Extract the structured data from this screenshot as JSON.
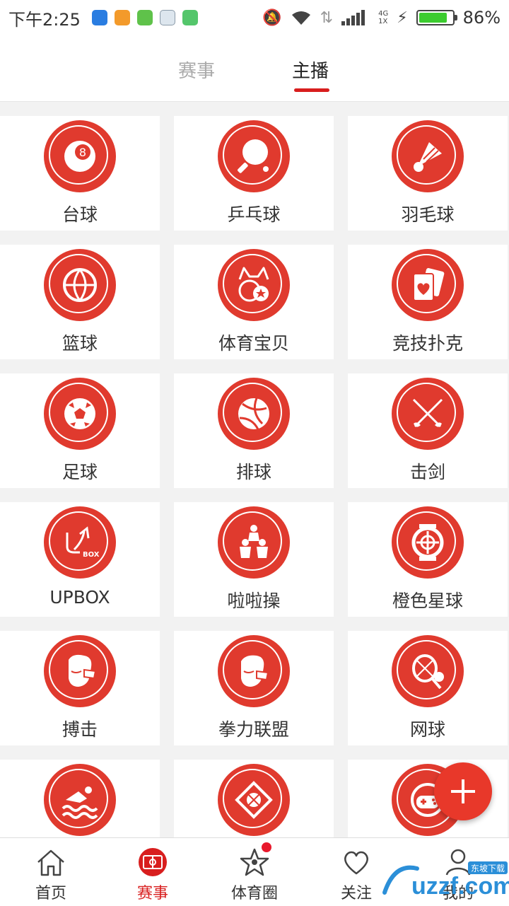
{
  "status_bar": {
    "time": "下午2:25",
    "network": "4G",
    "sim": "1X",
    "battery_percent": "86%",
    "battery_level": 0.86
  },
  "tabs": [
    {
      "label": "赛事",
      "active": false
    },
    {
      "label": "主播",
      "active": true
    }
  ],
  "categories": [
    {
      "label": "台球",
      "icon": "billiard-ball-icon"
    },
    {
      "label": "乒乓球",
      "icon": "ping-pong-icon"
    },
    {
      "label": "羽毛球",
      "icon": "shuttlecock-icon"
    },
    {
      "label": "篮球",
      "icon": "basketball-icon"
    },
    {
      "label": "体育宝贝",
      "icon": "cat-girl-icon"
    },
    {
      "label": "竞技扑克",
      "icon": "playing-cards-icon"
    },
    {
      "label": "足球",
      "icon": "soccer-ball-icon"
    },
    {
      "label": "排球",
      "icon": "volleyball-icon"
    },
    {
      "label": "击剑",
      "icon": "crossed-swords-icon"
    },
    {
      "label": "UPBOX",
      "icon": "upbox-logo-icon"
    },
    {
      "label": "啦啦操",
      "icon": "cheerleading-icon"
    },
    {
      "label": "橙色星球",
      "icon": "orange-planet-icon"
    },
    {
      "label": "搏击",
      "icon": "boxing-glove-icon"
    },
    {
      "label": "拳力联盟",
      "icon": "fist-league-icon"
    },
    {
      "label": "网球",
      "icon": "tennis-icon"
    },
    {
      "label": "",
      "icon": "swimming-icon"
    },
    {
      "label": "",
      "icon": "sport-x-icon"
    },
    {
      "label": "",
      "icon": "gamepad-icon"
    }
  ],
  "fab": {
    "icon": "plus-icon"
  },
  "bottom_nav": [
    {
      "label": "首页",
      "icon": "home-icon",
      "active": false
    },
    {
      "label": "赛事",
      "icon": "stadium-icon",
      "active": true
    },
    {
      "label": "体育圈",
      "icon": "star-pinwheel-icon",
      "active": false,
      "badge": true
    },
    {
      "label": "关注",
      "icon": "heart-icon",
      "active": false
    },
    {
      "label": "我的",
      "icon": "user-icon",
      "active": false
    }
  ],
  "watermark": {
    "text": "uzzf.com",
    "sub": "东坡下载"
  },
  "colors": {
    "accent": "#e03a2e",
    "active_tab": "#d81e1e",
    "fab": "#e8382a",
    "battery": "#3ccc2f"
  }
}
